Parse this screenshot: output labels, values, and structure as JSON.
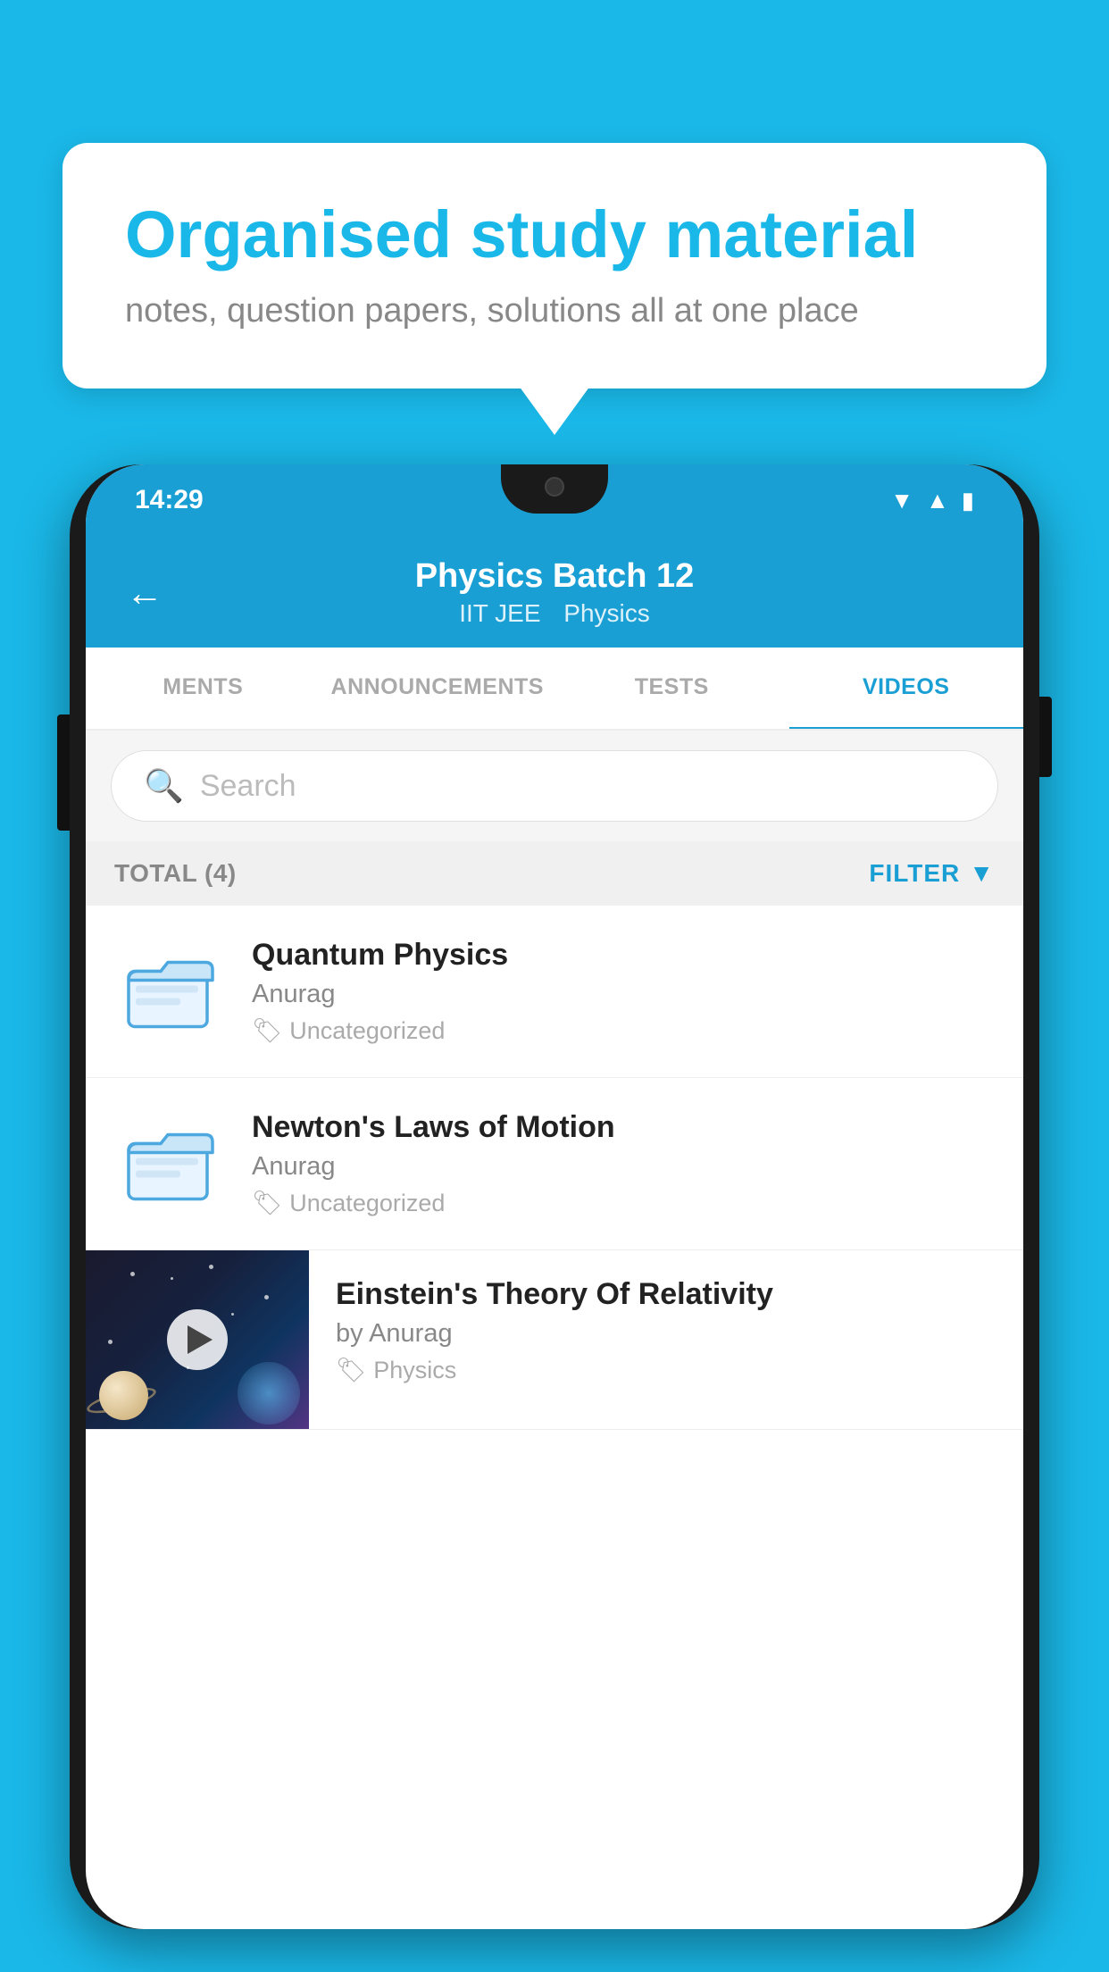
{
  "background_color": "#1ab8e8",
  "speech_bubble": {
    "title": "Organised study material",
    "subtitle": "notes, question papers, solutions all at one place"
  },
  "phone": {
    "status_bar": {
      "time": "14:29",
      "wifi": "▼",
      "signal": "▲",
      "battery": "▮"
    },
    "header": {
      "back_label": "←",
      "title": "Physics Batch 12",
      "subtitle_parts": [
        "IIT JEE",
        "Physics"
      ]
    },
    "tabs": [
      {
        "label": "MENTS",
        "active": false
      },
      {
        "label": "ANNOUNCEMENTS",
        "active": false
      },
      {
        "label": "TESTS",
        "active": false
      },
      {
        "label": "VIDEOS",
        "active": true
      }
    ],
    "search": {
      "placeholder": "Search"
    },
    "filter_bar": {
      "total_label": "TOTAL (4)",
      "filter_label": "FILTER"
    },
    "videos": [
      {
        "id": "quantum",
        "title": "Quantum Physics",
        "author": "Anurag",
        "tag": "Uncategorized",
        "type": "folder",
        "has_thumbnail": false
      },
      {
        "id": "newton",
        "title": "Newton's Laws of Motion",
        "author": "Anurag",
        "tag": "Uncategorized",
        "type": "folder",
        "has_thumbnail": false
      },
      {
        "id": "einstein",
        "title": "Einstein's Theory Of Relativity",
        "author": "by Anurag",
        "tag": "Physics",
        "type": "video",
        "has_thumbnail": true
      }
    ]
  }
}
